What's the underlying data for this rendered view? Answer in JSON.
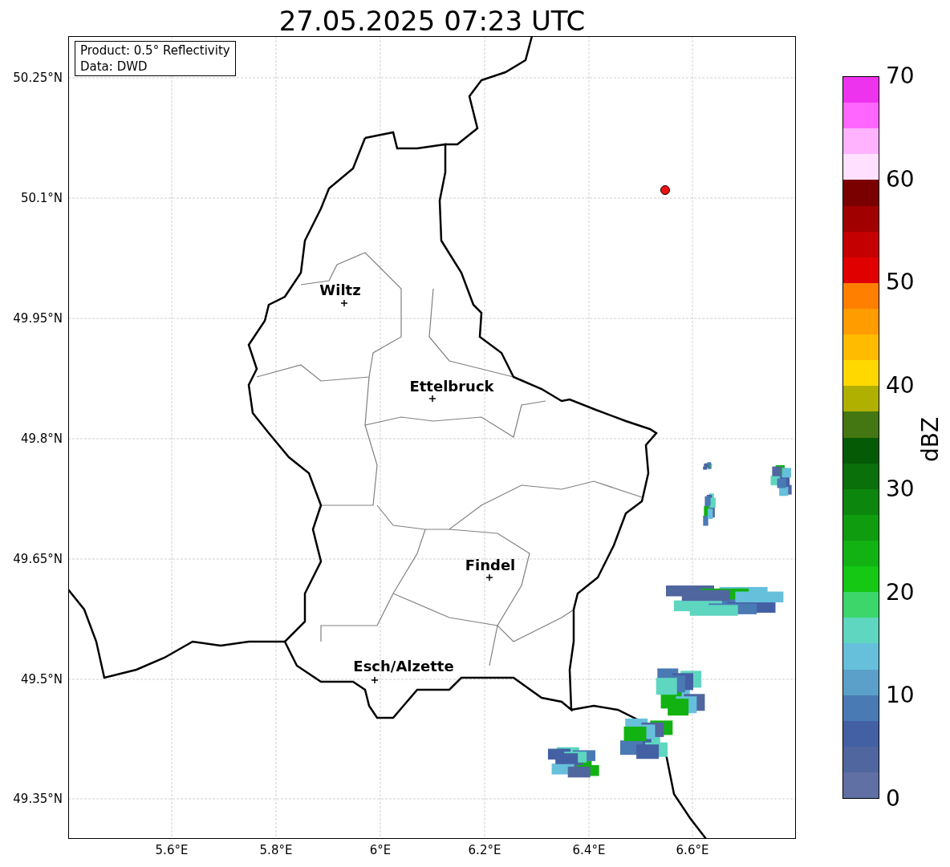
{
  "title": "27.05.2025 07:23 UTC",
  "info_box": [
    "Product: 0.5° Reflectivity",
    "Data: DWD"
  ],
  "lat_ticks": [
    "50.25°N",
    "50.1°N",
    "49.95°N",
    "49.8°N",
    "49.65°N",
    "49.5°N",
    "49.35°N"
  ],
  "lon_ticks": [
    "5.6°E",
    "5.8°E",
    "6°E",
    "6.2°E",
    "6.4°E",
    "6.6°E"
  ],
  "cities": [
    {
      "name": "Wiltz"
    },
    {
      "name": "Ettelbruck"
    },
    {
      "name": "Findel"
    },
    {
      "name": "Esch/Alzette"
    }
  ],
  "colorbar": {
    "label": "dBZ",
    "ticks": [
      "70",
      "60",
      "50",
      "40",
      "30",
      "20",
      "10",
      "0"
    ],
    "segments": [
      {
        "color": "#ee33ee"
      },
      {
        "color": "#ff66ff"
      },
      {
        "color": "#ffb3ff"
      },
      {
        "color": "#ffe0ff"
      },
      {
        "color": "#7a0000"
      },
      {
        "color": "#a00000"
      },
      {
        "color": "#c40000"
      },
      {
        "color": "#e00000"
      },
      {
        "color": "#ff7f00"
      },
      {
        "color": "#ff9c00"
      },
      {
        "color": "#ffbb00"
      },
      {
        "color": "#ffd800"
      },
      {
        "color": "#b0b000"
      },
      {
        "color": "#447711"
      },
      {
        "color": "#055a05"
      },
      {
        "color": "#0a700a"
      },
      {
        "color": "#0c860c"
      },
      {
        "color": "#0f9c0f"
      },
      {
        "color": "#12b212"
      },
      {
        "color": "#14c814"
      },
      {
        "color": "#3dd66b"
      },
      {
        "color": "#5ed6c0"
      },
      {
        "color": "#66c0dc"
      },
      {
        "color": "#5aa0c8"
      },
      {
        "color": "#4a7ab4"
      },
      {
        "color": "#4460a4"
      },
      {
        "color": "#50669f"
      },
      {
        "color": "#6070a4"
      }
    ]
  }
}
